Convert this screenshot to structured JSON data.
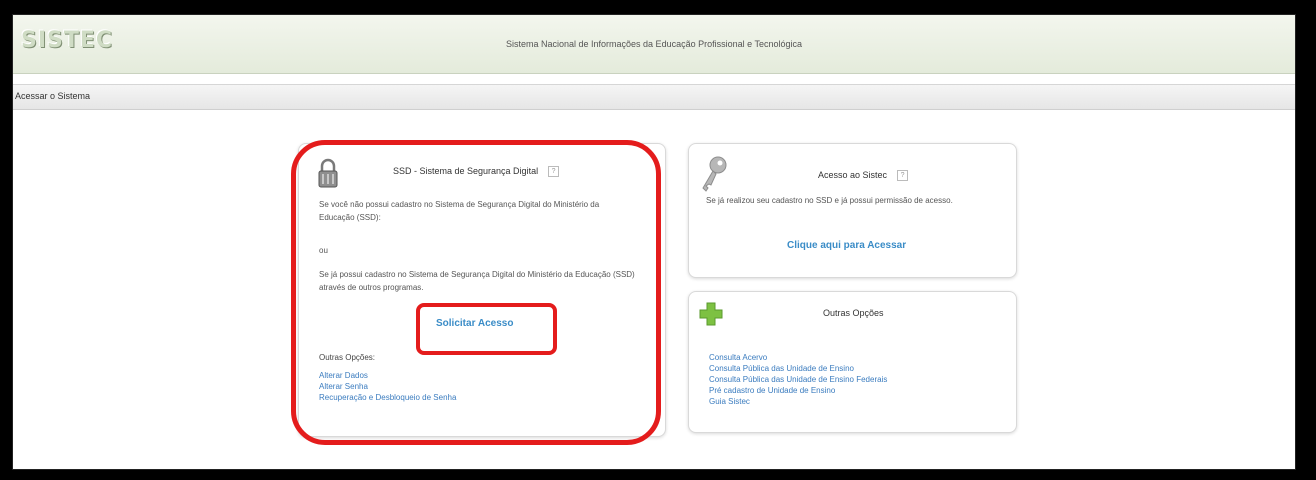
{
  "header": {
    "logo": "SISTEC",
    "system_title": "Sistema Nacional de Informações da Educação Profissional e Tecnológica"
  },
  "breadcrumb": "Acessar o Sistema",
  "ssd_card": {
    "title": "SSD - Sistema de Segurança Digital",
    "help": "?",
    "para1": "Se você não possui cadastro no Sistema de Segurança Digital do Ministério da Educação (SSD):",
    "or": "ou",
    "para2": "Se já possui cadastro no Sistema de Segurança Digital do Ministério da Educação (SSD) através de outros programas.",
    "cta": "Solicitar Acesso",
    "other_options_label": "Outras Opções:",
    "links": [
      "Alterar Dados",
      "Alterar Senha",
      "Recuperação e Desbloqueio de Senha"
    ]
  },
  "access_card": {
    "title": "Acesso ao Sistec",
    "help": "?",
    "text": "Se já realizou seu cadastro no SSD e já possui permissão de acesso.",
    "cta": "Clique aqui para Acessar"
  },
  "options_card": {
    "title": "Outras Opções",
    "links": [
      "Consulta Acervo",
      "Consulta Pública das Unidade de Ensino",
      "Consulta Pública das Unidade de Ensino Federais",
      "Pré cadastro de Unidade de Ensino",
      "Guia Sistec"
    ]
  },
  "colors": {
    "highlight": "#e41c1c",
    "link": "#3b7cbf",
    "cta": "#3a8cc7",
    "plus_icon": "#7dc142"
  }
}
